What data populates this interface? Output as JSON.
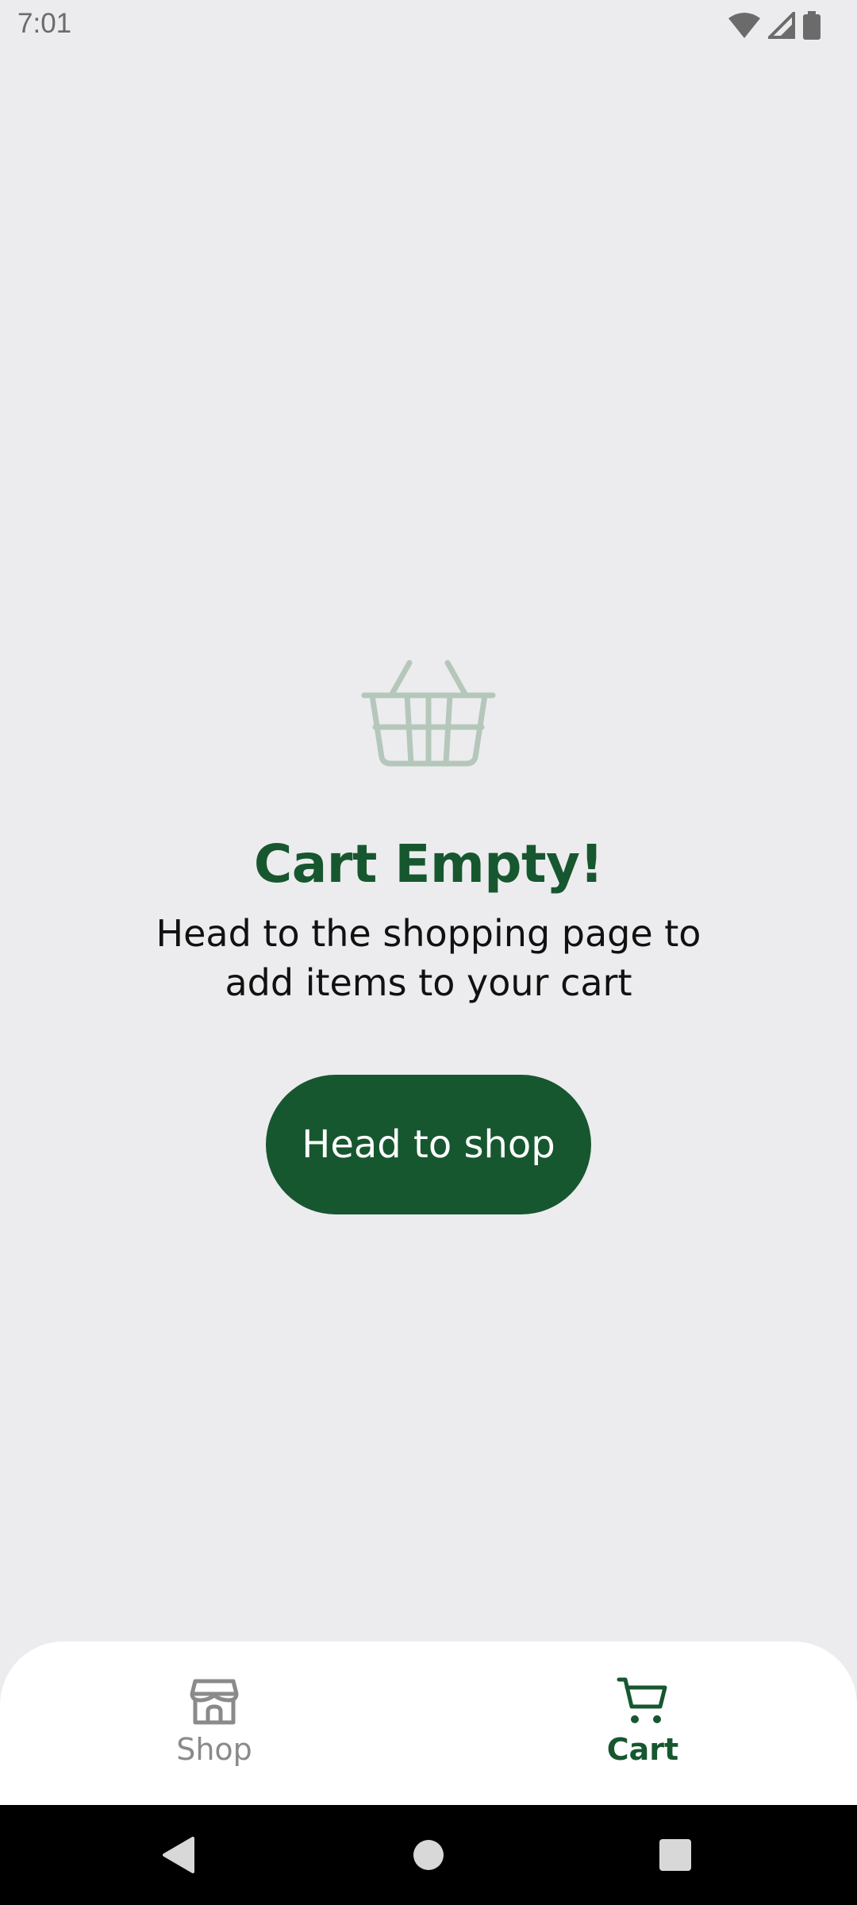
{
  "status_bar": {
    "time": "7:01",
    "icons": [
      "wifi-icon",
      "signal-icon",
      "battery-icon"
    ]
  },
  "empty_state": {
    "icon": "basket-icon",
    "title": "Cart Empty!",
    "description": "Head to the shopping page to add items to your cart",
    "button_label": "Head to shop"
  },
  "bottom_nav": {
    "items": [
      {
        "label": "Shop",
        "icon": "store-icon",
        "active": false
      },
      {
        "label": "Cart",
        "icon": "cart-icon",
        "active": true
      }
    ]
  },
  "system_nav": {
    "buttons": [
      "back-icon",
      "home-icon",
      "recents-icon"
    ]
  },
  "colors": {
    "brand_green": "#17572f",
    "basket_tint": "#b5c7bb",
    "background": "#ececee",
    "inactive_gray": "#8a8a8a"
  }
}
